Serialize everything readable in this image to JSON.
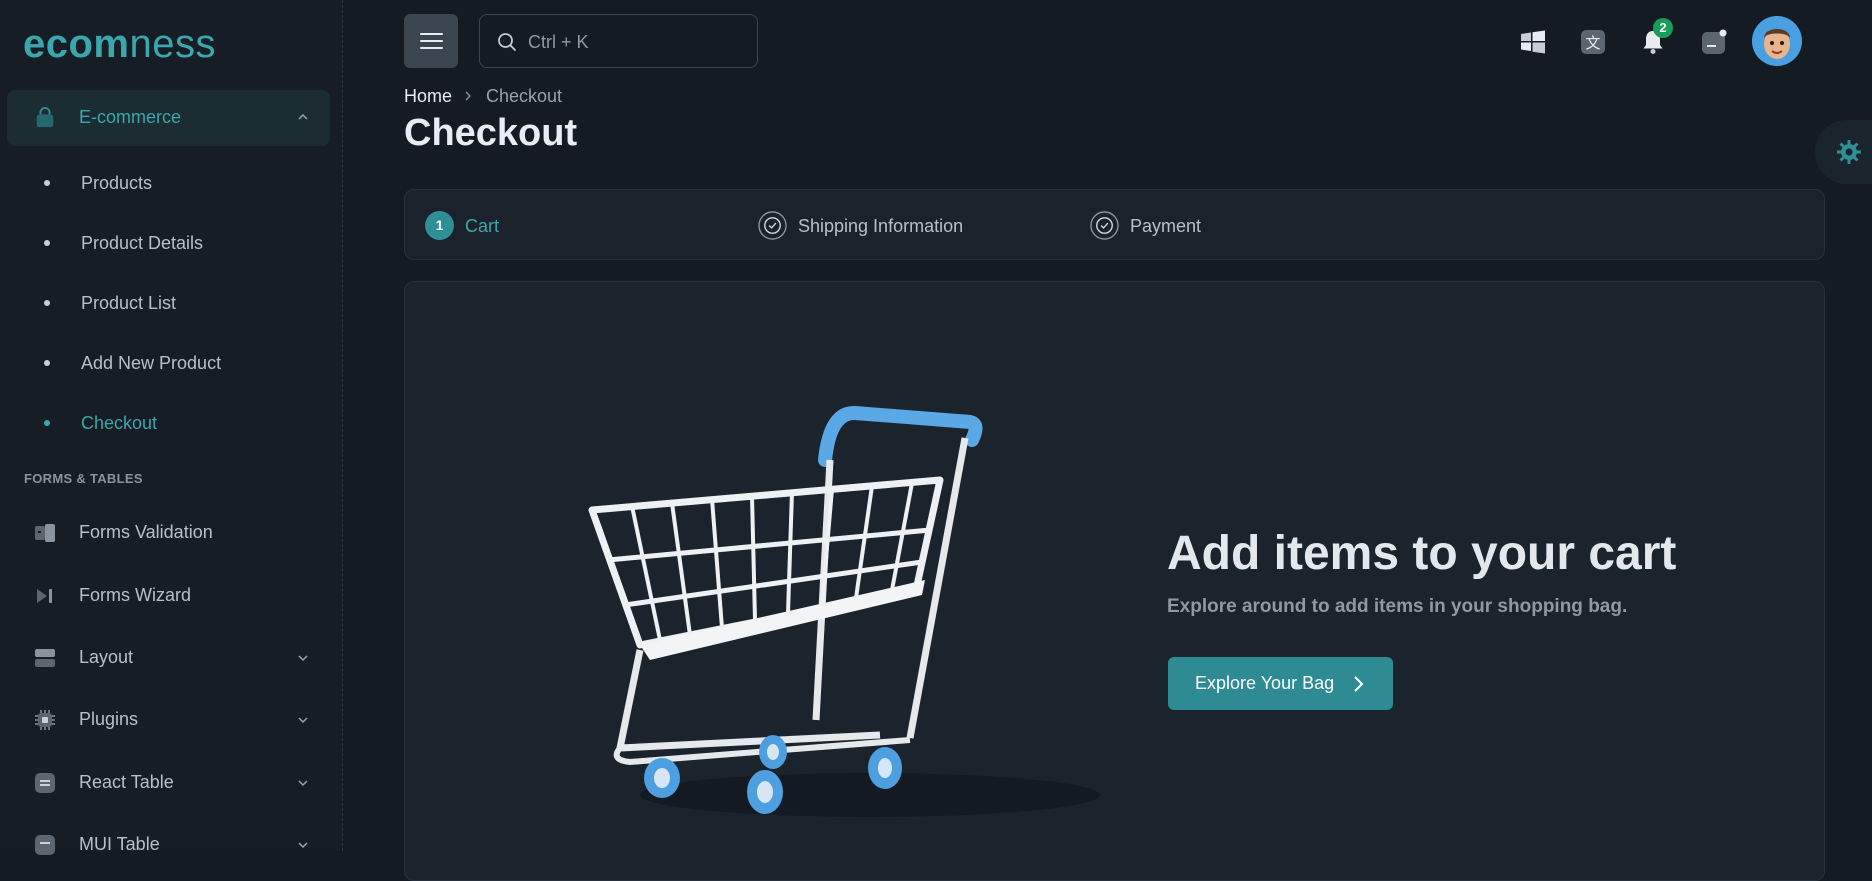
{
  "app": {
    "logo_part1": "ecom",
    "logo_part2": "ness"
  },
  "colors": {
    "accent": "#3aa7ac",
    "background": "#141b23",
    "sidebar": "#161d25",
    "button": "#2e8b93",
    "badge": "#14a05a"
  },
  "sidebar": {
    "parent": {
      "label": "E-commerce",
      "icon": "shopping-bag-icon",
      "expanded": true
    },
    "sub_items": [
      {
        "label": "Products",
        "active": false
      },
      {
        "label": "Product Details",
        "active": false
      },
      {
        "label": "Product List",
        "active": false
      },
      {
        "label": "Add New Product",
        "active": false
      },
      {
        "label": "Checkout",
        "active": true
      }
    ],
    "section_title": "FORMS & TABLES",
    "items": [
      {
        "label": "Forms Validation",
        "icon": "form-validation-icon",
        "has_chevron": false
      },
      {
        "label": "Forms Wizard",
        "icon": "wizard-icon",
        "has_chevron": false
      },
      {
        "label": "Layout",
        "icon": "layout-icon",
        "has_chevron": true
      },
      {
        "label": "Plugins",
        "icon": "chip-icon",
        "has_chevron": true
      },
      {
        "label": "React Table",
        "icon": "table-icon",
        "has_chevron": true
      },
      {
        "label": "MUI Table",
        "icon": "table-icon",
        "has_chevron": true
      }
    ]
  },
  "header": {
    "search_placeholder": "Ctrl + K",
    "notification_count": "2",
    "icons": [
      "menu-icon",
      "search-icon",
      "windows-icon",
      "translate-icon",
      "bell-icon",
      "message-icon",
      "avatar"
    ]
  },
  "breadcrumb": {
    "home": "Home",
    "current": "Checkout"
  },
  "page": {
    "title": "Checkout"
  },
  "stepper": {
    "steps": [
      {
        "number": "1",
        "label": "Cart",
        "active": true
      },
      {
        "label": "Shipping Information",
        "active": false
      },
      {
        "label": "Payment",
        "active": false
      }
    ]
  },
  "empty_cart": {
    "title": "Add items to your cart",
    "subtitle": "Explore around to add items in your shopping bag.",
    "button_label": "Explore Your Bag"
  }
}
